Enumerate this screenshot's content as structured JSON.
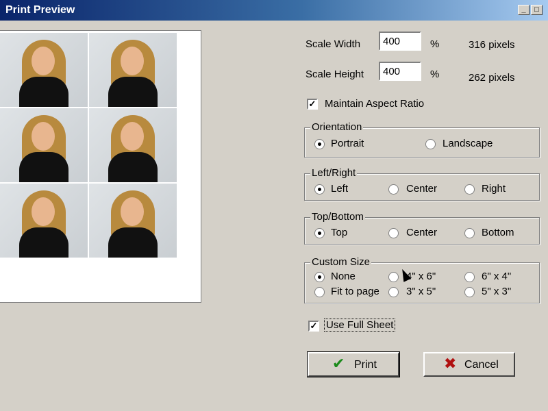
{
  "window": {
    "title": "Print Preview",
    "minimize_glyph": "_",
    "maximize_glyph": "□"
  },
  "preview": {
    "photos": [
      "portrait-1",
      "portrait-2",
      "portrait-3",
      "portrait-4",
      "portrait-5",
      "portrait-6"
    ]
  },
  "scale": {
    "width_label": "Scale Width",
    "width_value": "400",
    "width_unit": "%",
    "width_pixels": "316 pixels",
    "height_label": "Scale Height",
    "height_value": "400",
    "height_unit": "%",
    "height_pixels": "262 pixels"
  },
  "maintain_aspect": {
    "label": "Maintain Aspect Ratio",
    "checked": true,
    "mark": "✓"
  },
  "orientation": {
    "legend": "Orientation",
    "options": [
      "Portrait",
      "Landscape"
    ],
    "selected": "Portrait"
  },
  "left_right": {
    "legend": "Left/Right",
    "options": [
      "Left",
      "Center",
      "Right"
    ],
    "selected": "Left"
  },
  "top_bottom": {
    "legend": "Top/Bottom",
    "options": [
      "Top",
      "Center",
      "Bottom"
    ],
    "selected": "Top"
  },
  "custom_size": {
    "legend": "Custom Size",
    "options": [
      "None",
      "4\" x 6\"",
      "6\" x 4\"",
      "Fit to page",
      "3\" x 5\"",
      "5\" x 3\""
    ],
    "selected": "None"
  },
  "use_full_sheet": {
    "label": "Use Full Sheet",
    "checked": true,
    "mark": "✓"
  },
  "buttons": {
    "print_label": "Print",
    "print_icon": "✔",
    "print_icon_color": "#1a8a1a",
    "cancel_label": "Cancel",
    "cancel_icon": "✖",
    "cancel_icon_color": "#b01010"
  }
}
